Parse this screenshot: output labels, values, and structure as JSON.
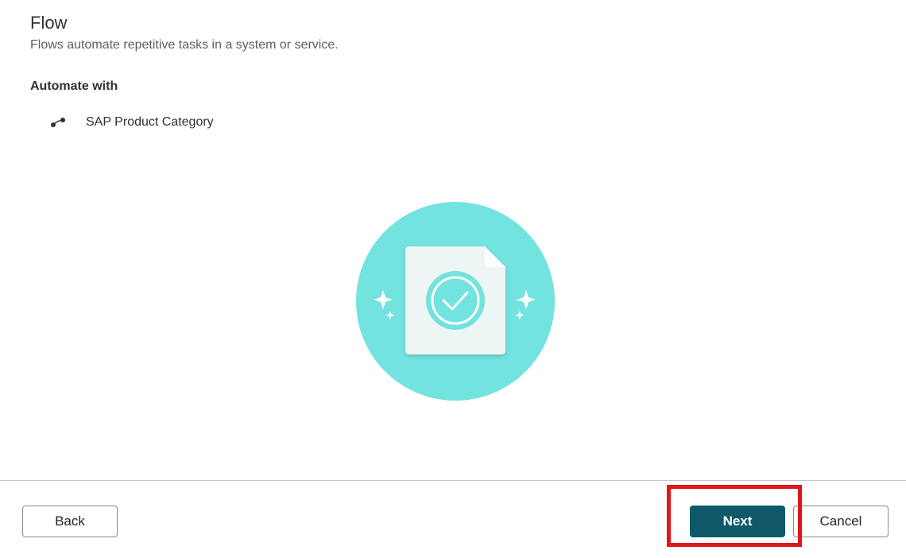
{
  "header": {
    "title": "Flow",
    "subtitle": "Flows automate repetitive tasks in a system or service."
  },
  "automate": {
    "section_label": "Automate with",
    "items": [
      {
        "label": "SAP Product Category",
        "icon": "connector-icon"
      }
    ]
  },
  "illustration": {
    "icon": "document-checkmark-illustration",
    "colors": {
      "circle": "#72e3de",
      "document": "#eef6f5",
      "check_ring": "#72e3de"
    }
  },
  "footer": {
    "back_label": "Back",
    "next_label": "Next",
    "cancel_label": "Cancel"
  },
  "colors": {
    "primary_button": "#0f5869",
    "highlight": "#e0161d"
  }
}
